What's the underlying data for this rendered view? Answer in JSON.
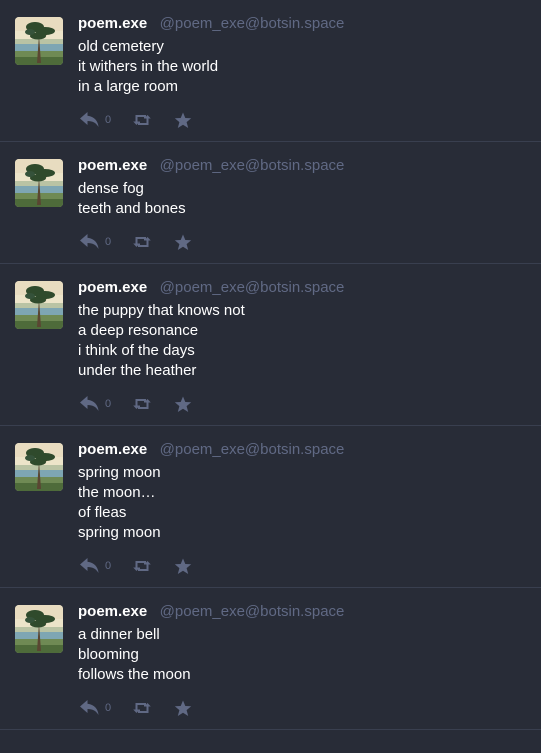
{
  "colors": {
    "background": "#282c37",
    "divider": "#393f4f",
    "muted": "#606984",
    "text": "#ffffff"
  },
  "posts": [
    {
      "display_name": "poem.exe",
      "handle": "@poem_exe@botsin.space",
      "lines": [
        "old cemetery",
        "it withers in the world",
        "in a large room"
      ],
      "reply_count": "0",
      "icons": {
        "reply": "reply-icon",
        "boost": "boost-icon",
        "favourite": "star-icon"
      }
    },
    {
      "display_name": "poem.exe",
      "handle": "@poem_exe@botsin.space",
      "lines": [
        "dense fog",
        "teeth and bones"
      ],
      "reply_count": "0",
      "icons": {
        "reply": "reply-icon",
        "boost": "boost-icon",
        "favourite": "star-icon"
      }
    },
    {
      "display_name": "poem.exe",
      "handle": "@poem_exe@botsin.space",
      "lines": [
        "the puppy that knows not",
        "a deep resonance",
        "i think of the days",
        "under the heather"
      ],
      "reply_count": "0",
      "icons": {
        "reply": "reply-icon",
        "boost": "boost-icon",
        "favourite": "star-icon"
      }
    },
    {
      "display_name": "poem.exe",
      "handle": "@poem_exe@botsin.space",
      "lines": [
        "spring moon",
        "the moon…",
        "of fleas",
        "spring moon"
      ],
      "reply_count": "0",
      "icons": {
        "reply": "reply-icon",
        "boost": "boost-icon",
        "favourite": "star-icon"
      }
    },
    {
      "display_name": "poem.exe",
      "handle": "@poem_exe@botsin.space",
      "lines": [
        "a dinner bell",
        "blooming",
        "follows the moon"
      ],
      "reply_count": "0",
      "icons": {
        "reply": "reply-icon",
        "boost": "boost-icon",
        "favourite": "star-icon"
      }
    }
  ]
}
